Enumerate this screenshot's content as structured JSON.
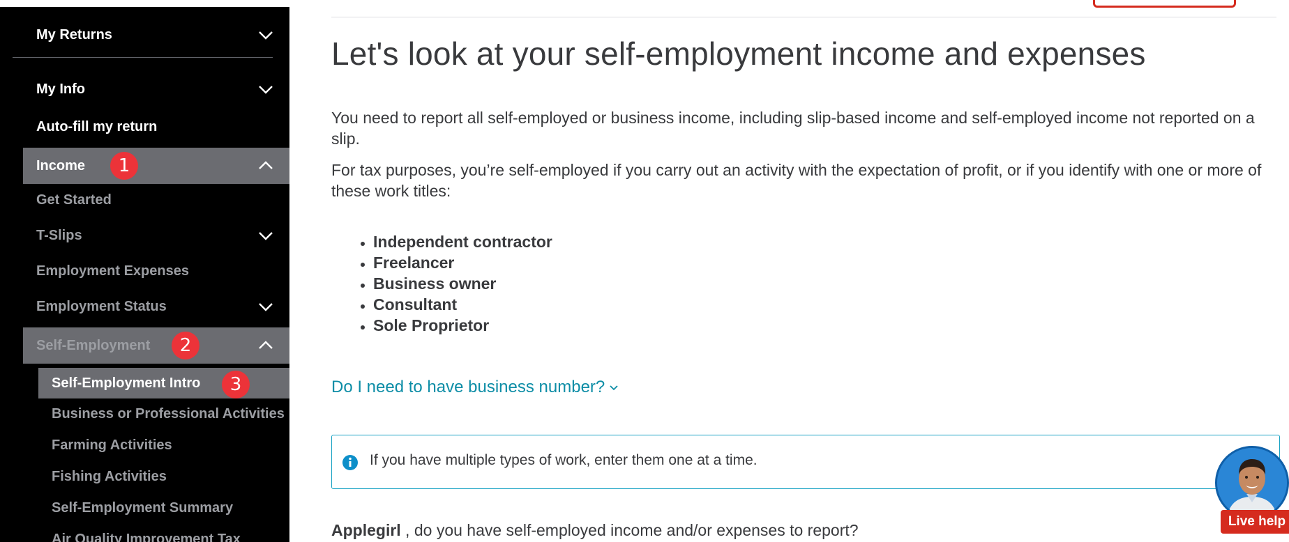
{
  "sidebar": {
    "my_returns": "My Returns",
    "my_info": "My Info",
    "autofill": "Auto-fill my return",
    "income": "Income",
    "income_badge": "1",
    "get_started": "Get Started",
    "t_slips": "T-Slips",
    "employment_expenses": "Employment Expenses",
    "employment_status": "Employment Status",
    "self_employment": "Self-Employment",
    "self_employment_badge": "2",
    "sub_items": [
      "Self-Employment Intro",
      "Business or Professional Activities",
      "Farming Activities",
      "Fishing Activities",
      "Self-Employment Summary",
      "Air Quality Improvement Tax"
    ],
    "intro_badge": "3"
  },
  "main": {
    "title": "Let's look at your self-employment income and expenses",
    "para1": "You need to report all self-employed or business income, including slip-based income and self-employed income not reported on a slip.",
    "para2": "For tax purposes, you’re self-employed if you carry out an activity with the expectation of profit, or if you identify with one or more of these work titles:",
    "work_titles": [
      "Independent contractor",
      "Freelancer",
      "Business owner",
      "Consultant",
      "Sole Proprietor"
    ],
    "faq_link": "Do I need to have business number?",
    "info_text": "If you have multiple types of work, enter them one at a time.",
    "user_name": "Applegirl",
    "question": " , do you have self-employed income and/or expenses to report?"
  },
  "live_help": {
    "label": "Live help"
  },
  "colors": {
    "sidebar_bg": "#000000",
    "highlight": "#6b6c71",
    "badge": "#ec3339",
    "link": "#0d8da6",
    "info_border": "#1aa3c4",
    "brand_red": "#d52b1e"
  }
}
